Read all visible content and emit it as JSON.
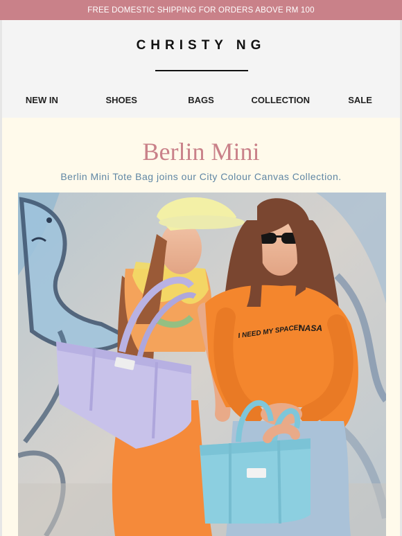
{
  "promo": {
    "text": "FREE DOMESTIC SHIPPING FOR ORDERS ABOVE RM 100"
  },
  "header": {
    "logo": "CHRISTY NG"
  },
  "nav": {
    "items": [
      {
        "label": "NEW IN"
      },
      {
        "label": "SHOES"
      },
      {
        "label": "BAGS"
      },
      {
        "label": "COLLECTION"
      },
      {
        "label": "SALE"
      }
    ]
  },
  "content": {
    "title": "Berlin Mini",
    "subtitle": "Berlin Mini Tote Bag joins our City Colour Canvas Collection."
  },
  "hero": {
    "sweatshirt_text": "I NEED MY SPACE!",
    "sweatshirt_logo": "NASA"
  },
  "colors": {
    "promo_bg": "#c98189",
    "page_bg": "#fffaeb",
    "header_bg": "#f4f4f4",
    "title": "#c98189",
    "subtitle": "#5f86a4",
    "lilac_bag": "#c8c2ea",
    "blue_bag": "#8ccfe0",
    "orange": "#f4862d"
  }
}
